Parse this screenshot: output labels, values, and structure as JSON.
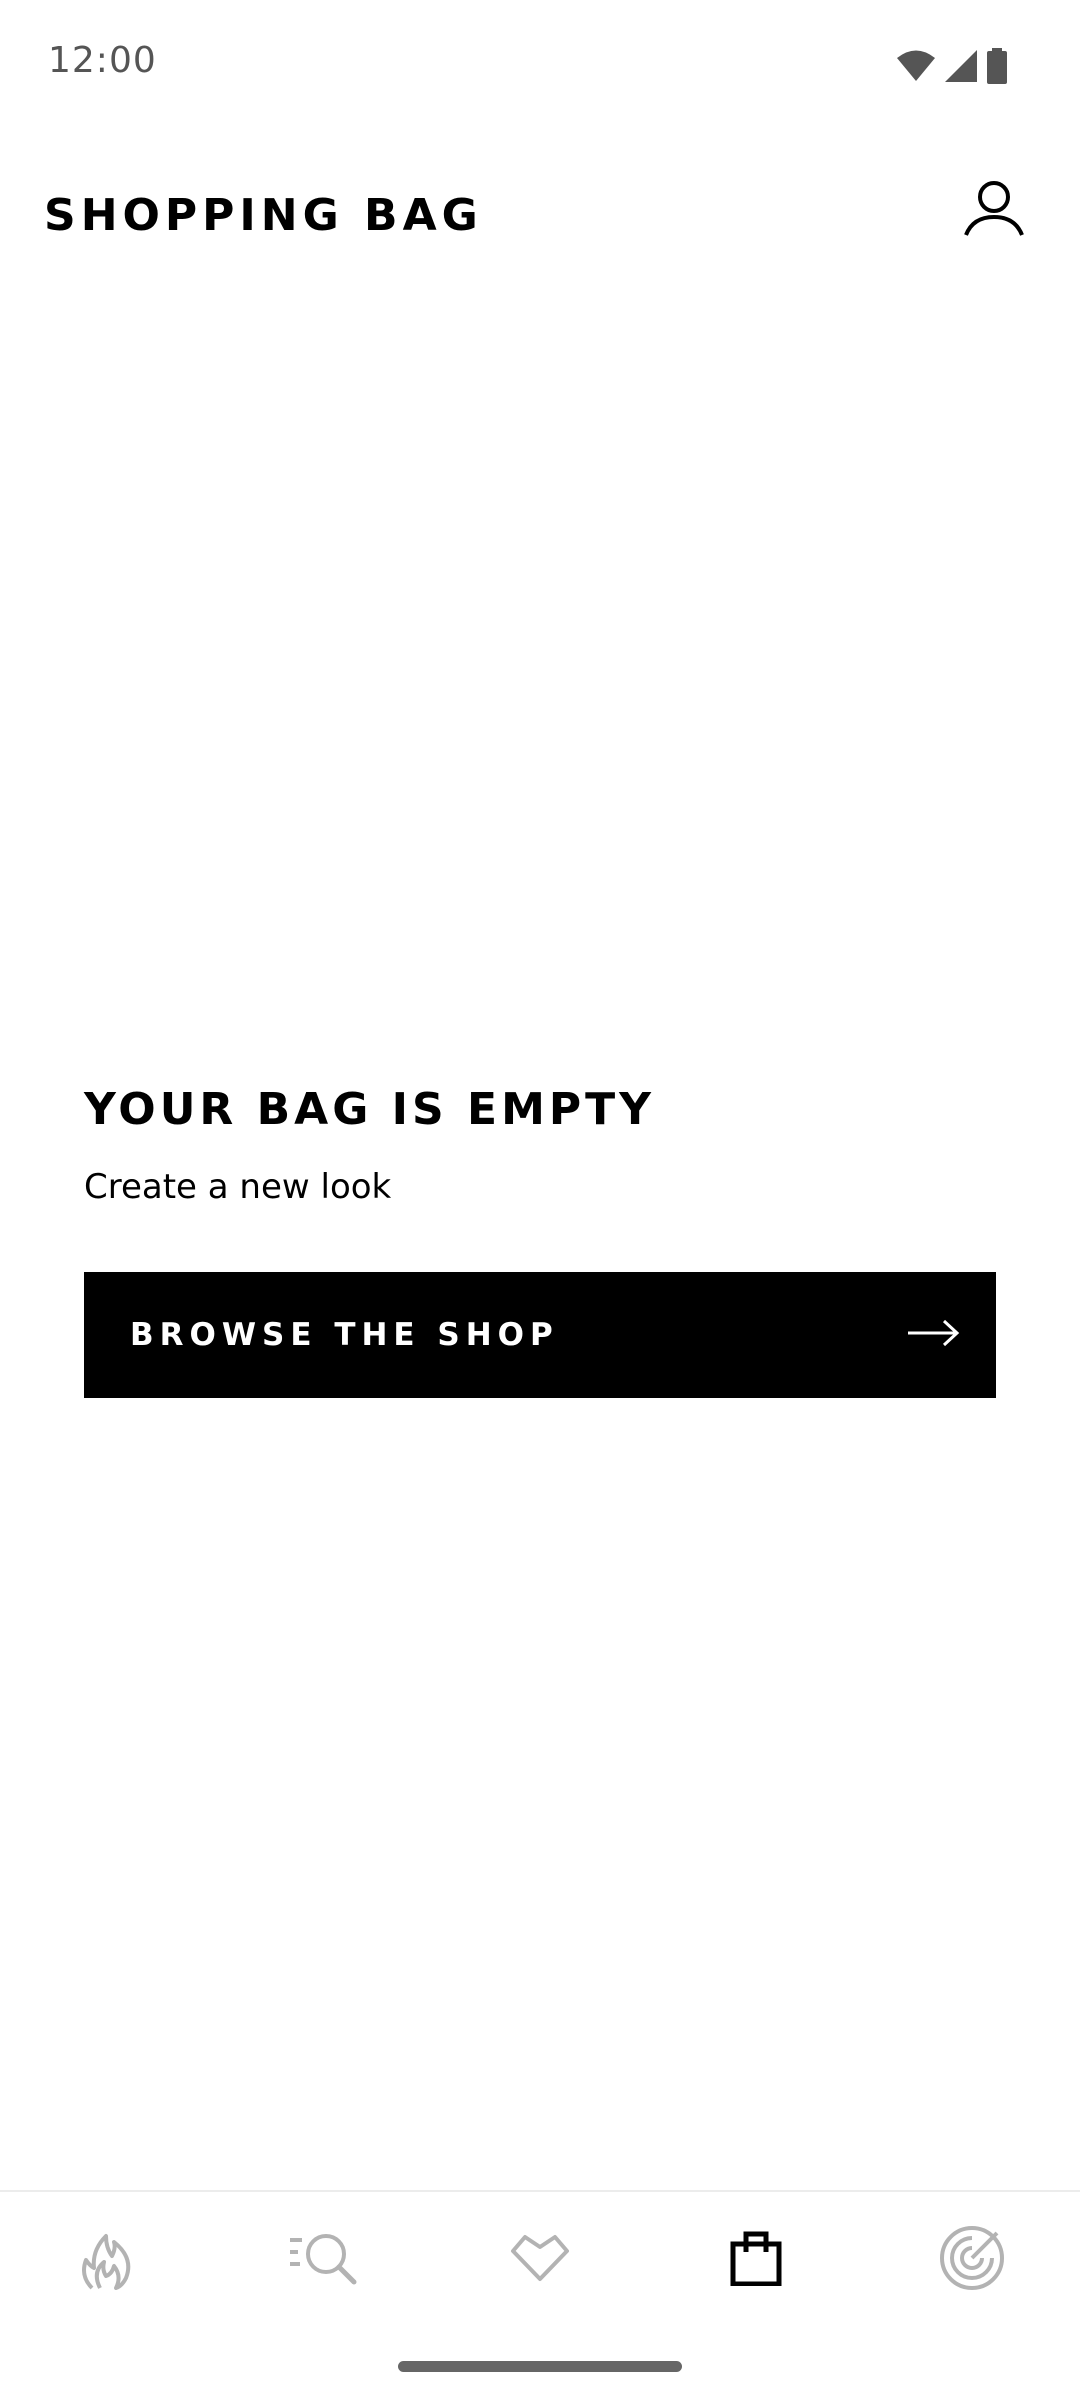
{
  "status_bar": {
    "time": "12:00",
    "icons": [
      "wifi-icon",
      "cell-signal-icon",
      "battery-icon"
    ]
  },
  "header": {
    "title": "SHOPPING BAG",
    "account_icon": "person-icon"
  },
  "empty_state": {
    "title": "YOUR BAG IS EMPTY",
    "subtitle": "Create a new look",
    "button_label": "BROWSE THE SHOP",
    "button_icon": "arrow-right-icon"
  },
  "bottom_nav": {
    "items": [
      {
        "icon": "flame-icon",
        "active": false
      },
      {
        "icon": "search-icon",
        "active": false
      },
      {
        "icon": "heart-icon",
        "active": false
      },
      {
        "icon": "bag-icon",
        "active": true
      },
      {
        "icon": "radar-icon",
        "active": false
      }
    ]
  },
  "colors": {
    "primary": "#000000",
    "background": "#ffffff",
    "inactive_icon": "#b3b3b3",
    "status_text": "#555555"
  }
}
